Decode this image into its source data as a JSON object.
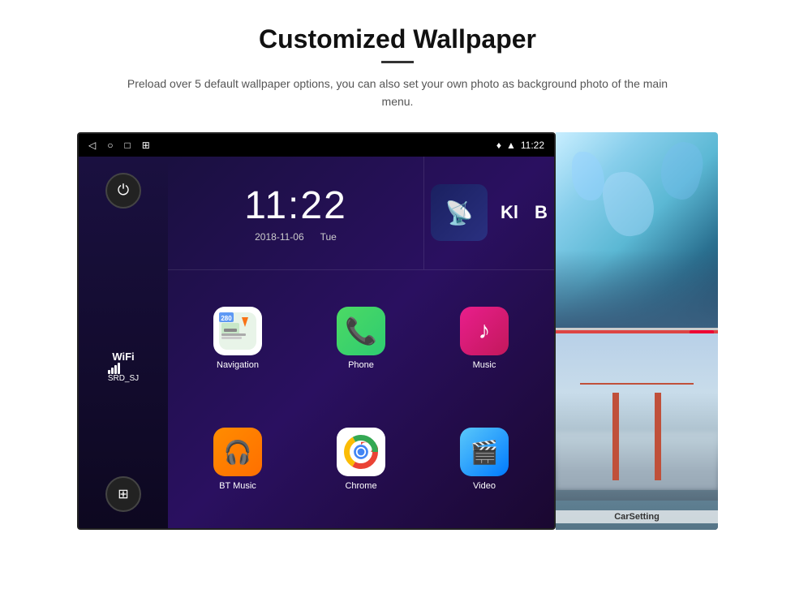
{
  "page": {
    "title": "Customized Wallpaper",
    "divider": "—",
    "subtitle": "Preload over 5 default wallpaper options, you can also set your own photo as background photo of the main menu."
  },
  "statusBar": {
    "time": "11:22",
    "icons": [
      "◁",
      "○",
      "□",
      "⊞"
    ]
  },
  "clock": {
    "time": "11:22",
    "date": "2018-11-06",
    "day": "Tue"
  },
  "wifi": {
    "label": "WiFi",
    "network": "SRD_SJ"
  },
  "apps": [
    {
      "name": "Navigation",
      "type": "navigation"
    },
    {
      "name": "Phone",
      "type": "phone"
    },
    {
      "name": "Music",
      "type": "music"
    },
    {
      "name": "BT Music",
      "type": "btmusic"
    },
    {
      "name": "Chrome",
      "type": "chrome"
    },
    {
      "name": "Video",
      "type": "video"
    }
  ],
  "wallpapers": [
    {
      "name": "ice-cave",
      "label": ""
    },
    {
      "name": "golden-gate",
      "label": "CarSetting"
    }
  ],
  "mediaIcons": {
    "kl": "Kl",
    "b": "B"
  }
}
